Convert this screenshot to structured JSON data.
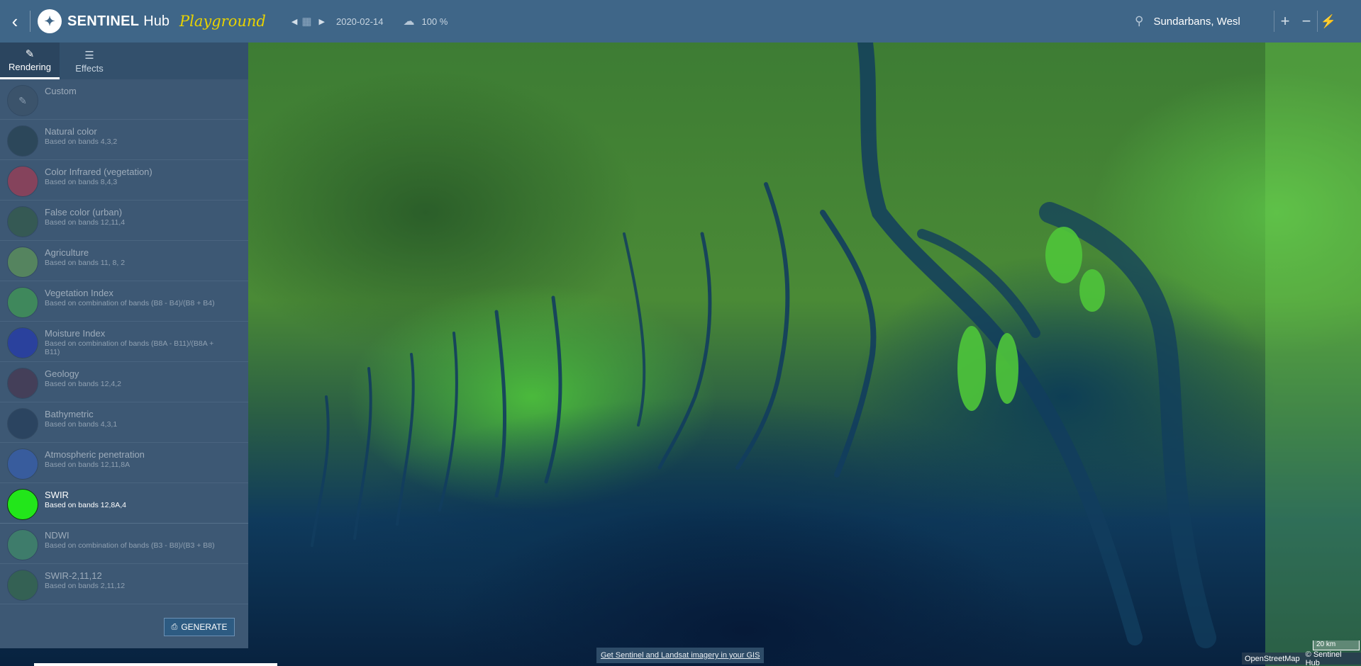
{
  "topbar": {
    "back_icon": "chevron-left-icon",
    "logo": {
      "sentinel": "SENTINEL",
      "hub": "Hub",
      "playground": "Playground"
    },
    "date": "2020-02-14",
    "cloud_coverage": "100 %",
    "search_value": "Sundarbans, Wesl",
    "zoom_in": "+",
    "zoom_out": "−"
  },
  "sidebar": {
    "tabs": [
      {
        "label": "Rendering",
        "icon": "brush-icon",
        "active": true
      },
      {
        "label": "Effects",
        "icon": "sliders-icon",
        "active": false
      }
    ],
    "items": [
      {
        "title": "Custom",
        "desc": "",
        "color": "#3a4f64"
      },
      {
        "title": "Natural color",
        "desc": "Based on bands 4,3,2",
        "color": "#1f3a45"
      },
      {
        "title": "Color Infrared (vegetation)",
        "desc": "Based on bands 8,4,3",
        "color": "#c0324a"
      },
      {
        "title": "False color (urban)",
        "desc": "Based on bands 12,11,4",
        "color": "#2f5a3a"
      },
      {
        "title": "Agriculture",
        "desc": "Based on bands 11, 8, 2",
        "color": "#6aa84f"
      },
      {
        "title": "Vegetation Index",
        "desc": "Based on combination of bands (B8 - B4)/(B8 + B4)",
        "color": "#42b04a"
      },
      {
        "title": "Moisture Index",
        "desc": "Based on combination of bands (B8A - B11)/(B8A + B11)",
        "color": "#1b2fc0"
      },
      {
        "title": "Geology",
        "desc": "Based on bands 12,4,2",
        "color": "#4a2c44"
      },
      {
        "title": "Bathymetric",
        "desc": "Based on bands 4,3,1",
        "color": "#1e3550"
      },
      {
        "title": "Atmospheric penetration",
        "desc": "Based on bands 12,11,8A",
        "color": "#3560c0"
      },
      {
        "title": "SWIR",
        "desc": "Based on bands 12,8A,4",
        "color": "#22e61a",
        "selected": true
      },
      {
        "title": "NDWI",
        "desc": "Based on combination of bands (B3 - B8)/(B3 + B8)",
        "color": "#3f9a64"
      },
      {
        "title": "SWIR-2,11,12",
        "desc": "Based on bands 2,11,12",
        "color": "#2d6a3a"
      }
    ],
    "generate_label": "GENERATE"
  },
  "footer": {
    "gis_link": "Get Sentinel and Landsat imagery in your GIS",
    "scale": "20 km",
    "attribution_osm": "OpenStreetMap",
    "attribution_sh": "© Sentinel Hub"
  }
}
